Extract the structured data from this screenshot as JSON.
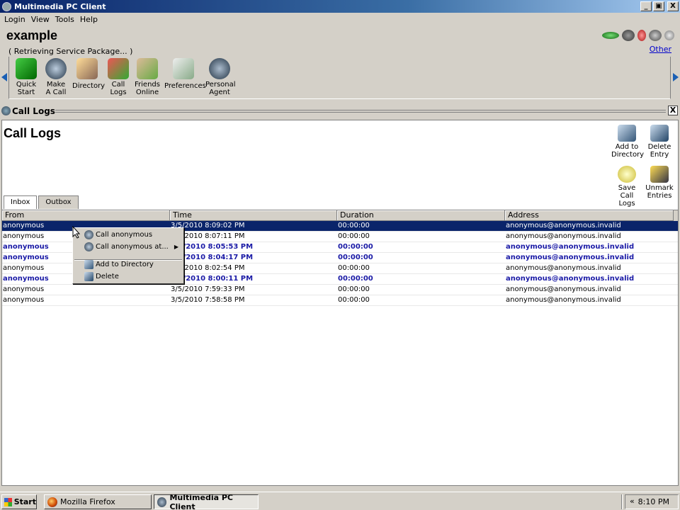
{
  "window": {
    "title": "Multimedia PC Client",
    "buttons": {
      "minimize": "_",
      "maximize": "▣",
      "close": "X"
    }
  },
  "menu": [
    "Login",
    "View",
    "Tools",
    "Help"
  ],
  "header": {
    "user": "example",
    "status": "( Retrieving Service Package... )",
    "other_link": "Other"
  },
  "toolbar": {
    "items": [
      {
        "label1": "Quick",
        "label2": "Start",
        "icon": "flag-icon"
      },
      {
        "label1": "Make",
        "label2": "A Call",
        "icon": "phone-icon"
      },
      {
        "label1": "Directory",
        "label2": "",
        "icon": "directory-icon"
      },
      {
        "label1": "Call",
        "label2": "Logs",
        "icon": "call-logs-icon"
      },
      {
        "label1": "Friends",
        "label2": "Online",
        "icon": "friends-icon"
      },
      {
        "label1": "Preferences",
        "label2": "",
        "icon": "preferences-icon"
      },
      {
        "label1": "Personal",
        "label2": "Agent",
        "icon": "agent-icon"
      }
    ]
  },
  "pane": {
    "title": "Call Logs",
    "close": "X"
  },
  "content": {
    "title": "Call Logs",
    "actions": [
      {
        "label1": "Add to",
        "label2": "Directory"
      },
      {
        "label1": "Delete",
        "label2": "Entry"
      },
      {
        "label1": "Save",
        "label2": "Call Logs"
      },
      {
        "label1": "Unmark",
        "label2": "Entries"
      }
    ],
    "tabs": [
      "Inbox",
      "Outbox"
    ]
  },
  "table": {
    "columns": [
      "From",
      "Time",
      "Duration",
      "Address"
    ],
    "rows": [
      {
        "from": "anonymous",
        "time": "3/5/2010 8:09:02 PM",
        "duration": "00:00:00",
        "address": "anonymous@anonymous.invalid"
      },
      {
        "from": "anonymous",
        "time": "3/5/2010 8:07:11 PM",
        "duration": "00:00:00",
        "address": "anonymous@anonymous.invalid"
      },
      {
        "from": "anonymous",
        "time": "3/5/2010 8:05:53 PM",
        "duration": "00:00:00",
        "address": "anonymous@anonymous.invalid"
      },
      {
        "from": "anonymous",
        "time": "3/5/2010 8:04:17 PM",
        "duration": "00:00:00",
        "address": "anonymous@anonymous.invalid"
      },
      {
        "from": "anonymous",
        "time": "3/5/2010 8:02:54 PM",
        "duration": "00:00:00",
        "address": "anonymous@anonymous.invalid"
      },
      {
        "from": "anonymous",
        "time": "3/5/2010 8:00:11 PM",
        "duration": "00:00:00",
        "address": "anonymous@anonymous.invalid"
      },
      {
        "from": "anonymous",
        "time": "3/5/2010 7:59:33 PM",
        "duration": "00:00:00",
        "address": "anonymous@anonymous.invalid"
      },
      {
        "from": "anonymous",
        "time": "3/5/2010 7:58:58 PM",
        "duration": "00:00:00",
        "address": "anonymous@anonymous.invalid"
      }
    ]
  },
  "context_menu": {
    "items": [
      "Call anonymous",
      "Call anonymous at...",
      "Add to Directory",
      "Delete"
    ],
    "submenu_arrow": "▶"
  },
  "taskbar": {
    "start": "Start",
    "tasks": [
      "Mozilla Firefox",
      "Multimedia PC Client"
    ],
    "tray_chevron": "«",
    "clock": "8:10 PM"
  },
  "colors": {
    "selection": "#0a246a",
    "unread_text": "#1a1aa6",
    "titlebar": "#0a246a"
  }
}
